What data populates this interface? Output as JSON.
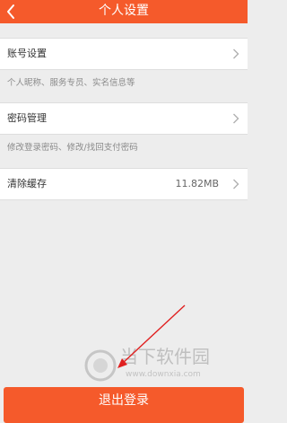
{
  "header": {
    "title": "个人设置",
    "back_icon": "chevron-left-icon"
  },
  "settings": [
    {
      "label": "账号设置",
      "description": "个人昵称、服务专员、实名信息等"
    },
    {
      "label": "密码管理",
      "description": "修改登录密码、修改/找回支付密码"
    },
    {
      "label": "清除缓存",
      "value": "11.82MB"
    }
  ],
  "footer": {
    "logout_label": "退出登录"
  },
  "watermark": {
    "name": "当下软件园",
    "url": "www.downxia.com"
  },
  "colors": {
    "brand": "#f55a2b",
    "background": "#ededed",
    "annotation_arrow": "#e02020"
  }
}
